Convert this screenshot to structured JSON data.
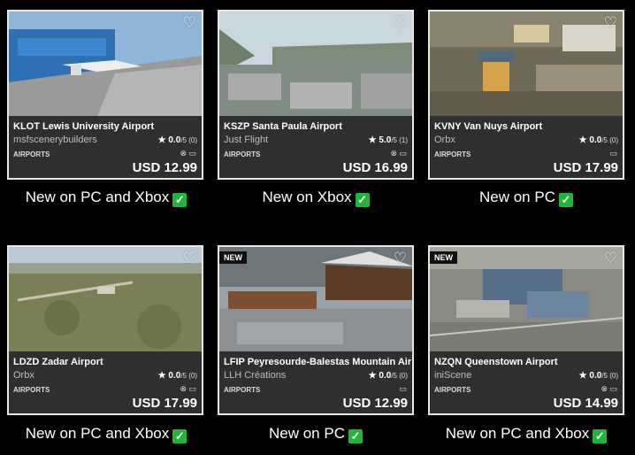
{
  "cards": [
    {
      "title": "KLOT Lewis University Airport",
      "publisher": "msfscenerybuilders",
      "rating": "★ 0.0",
      "rating_scale": "/5 (0)",
      "category": "AIRPORTS",
      "platforms": "⊗ ▭",
      "price": "USD 12.99",
      "badge": "",
      "caption": "New on PC and Xbox",
      "check": "✓"
    },
    {
      "title": "KSZP Santa Paula Airport",
      "publisher": "Just Flight",
      "rating": "★ 5.0",
      "rating_scale": "/5 (1)",
      "category": "AIRPORTS",
      "platforms": "⊗ ▭",
      "price": "USD 16.99",
      "badge": "",
      "caption": "New on Xbox",
      "check": "✓"
    },
    {
      "title": "KVNY Van Nuys Airport",
      "publisher": "Orbx",
      "rating": "★ 0.0",
      "rating_scale": "/5 (0)",
      "category": "AIRPORTS",
      "platforms": "▭",
      "price": "USD 17.99",
      "badge": "",
      "caption": "New on PC",
      "check": "✓"
    },
    {
      "title": "LDZD Zadar Airport",
      "publisher": "Orbx",
      "rating": "★ 0.0",
      "rating_scale": "/5 (0)",
      "category": "AIRPORTS",
      "platforms": "⊗ ▭",
      "price": "USD 17.99",
      "badge": "",
      "caption": "New on PC and Xbox",
      "check": "✓"
    },
    {
      "title": "LFIP Peyresourde-Balestas Mountain Airfie",
      "publisher": "LLH Créations",
      "rating": "★ 0.0",
      "rating_scale": "/5 (0)",
      "category": "AIRPORTS",
      "platforms": "▭",
      "price": "USD 12.99",
      "badge": "NEW",
      "caption": "New on PC",
      "check": "✓"
    },
    {
      "title": "NZQN Queenstown Airport",
      "publisher": "iniScene",
      "rating": "★ 0.0",
      "rating_scale": "/5 (0)",
      "category": "AIRPORTS",
      "platforms": "⊗ ▭",
      "price": "USD 14.99",
      "badge": "NEW",
      "caption": "New on PC and Xbox",
      "check": "✓"
    }
  ],
  "heart_icon": "♡"
}
